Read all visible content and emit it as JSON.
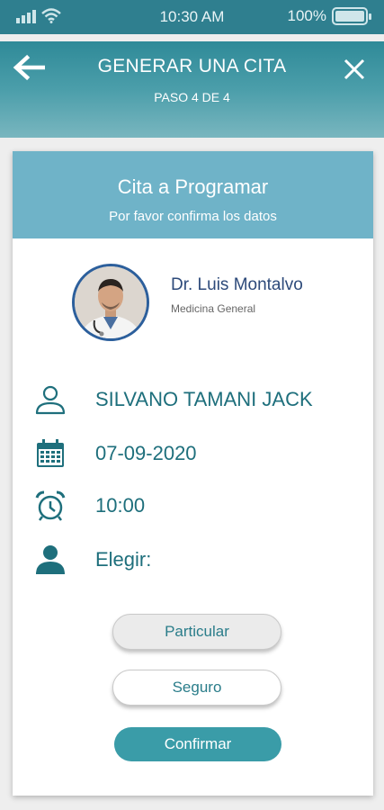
{
  "status_bar": {
    "time": "10:30 AM",
    "battery": "100%",
    "battery_level": 1.0
  },
  "header": {
    "title": "GENERAR UNA CITA",
    "step": "PASO 4 DE 4",
    "back_icon": "arrow-left-icon",
    "close_icon": "close-icon"
  },
  "card": {
    "title": "Cita  a Programar",
    "subtitle": "Por favor confirma los datos"
  },
  "doctor": {
    "name": "Dr. Luis Montalvo",
    "specialty": "Medicina General"
  },
  "details": {
    "patient": "SILVANO TAMANI JACK",
    "date": "07-09-2020",
    "time": "10:00",
    "choose_label": "Elegir:"
  },
  "buttons": {
    "particular": "Particular",
    "seguro": "Seguro",
    "confirmar": "Confirmar"
  },
  "colors": {
    "primary": "#3a9ca8",
    "header": "#2f8a98",
    "card_header": "#6fb3c8",
    "text_teal": "#1e6f7c",
    "doctor_name": "#2d4a7a"
  }
}
